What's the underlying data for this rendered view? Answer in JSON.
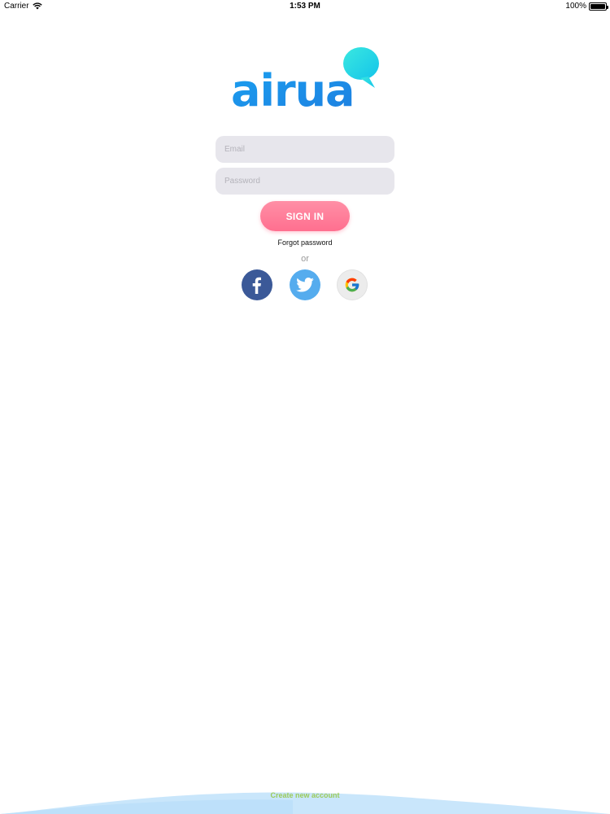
{
  "status_bar": {
    "carrier": "Carrier",
    "time": "1:53 PM",
    "battery": "100%",
    "battery_level": 1.0
  },
  "logo": {
    "text": "airua",
    "colors": {
      "primary": "#1aa8f0",
      "secondary": "#2ad4e6"
    }
  },
  "form": {
    "email_placeholder": "Email",
    "password_placeholder": "Password",
    "signin_label": "SIGN IN",
    "forgot_label": "Forgot password",
    "or_label": "or"
  },
  "social": [
    {
      "name": "facebook",
      "icon": "facebook-icon",
      "color": "#3b5998"
    },
    {
      "name": "twitter",
      "icon": "twitter-icon",
      "color": "#55acee"
    },
    {
      "name": "google",
      "icon": "google-icon",
      "color": "#ececec"
    }
  ],
  "footer": {
    "create_account_label": "Create new account",
    "create_account_color": "#9ccb5a",
    "wave_color": "#c9e6fb"
  }
}
